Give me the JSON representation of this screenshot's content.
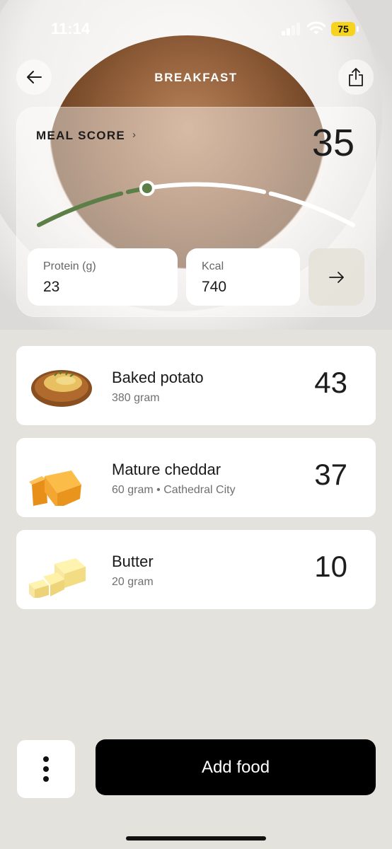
{
  "status_bar": {
    "time": "11:14",
    "battery": "75"
  },
  "header": {
    "title": "BREAKFAST"
  },
  "meal_score": {
    "label": "MEAL SCORE",
    "chevron": "›",
    "value": "35",
    "gauge_level": 0.35,
    "accent_color": "#5b7f46"
  },
  "stats": {
    "protein": {
      "label": "Protein (g)",
      "value": "23"
    },
    "kcal": {
      "label": "Kcal",
      "value": "740"
    }
  },
  "foods": [
    {
      "name": "Baked potato",
      "detail": "380 gram",
      "score": "43",
      "icon": "baked-potato-icon"
    },
    {
      "name": "Mature cheddar",
      "detail": "60 gram • Cathedral City",
      "score": "37",
      "icon": "cheddar-icon"
    },
    {
      "name": "Butter",
      "detail": "20 gram",
      "score": "10",
      "icon": "butter-icon"
    }
  ],
  "actions": {
    "add_food": "Add food"
  }
}
